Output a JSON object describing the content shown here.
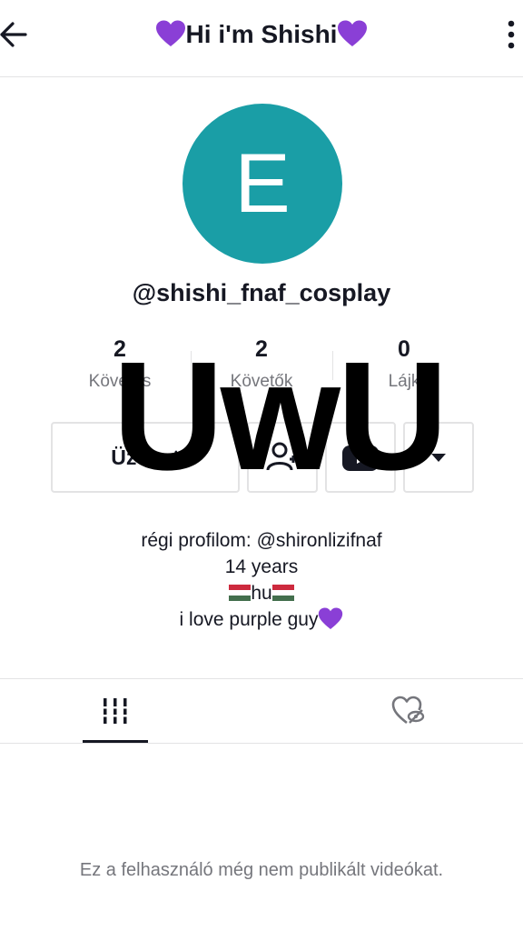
{
  "header": {
    "title": "Hi i'm Shishi",
    "back_icon": "arrow-left-icon",
    "more_icon": "more-vertical-icon",
    "heart_icon": "purple-heart-icon"
  },
  "profile": {
    "avatar_letter": "E",
    "avatar_color": "#1a9ea6",
    "username": "@shishi_fnaf_cosplay"
  },
  "stats": [
    {
      "value": "2",
      "label": "Követés"
    },
    {
      "value": "2",
      "label": "Követők"
    },
    {
      "value": "0",
      "label": "Lájk"
    }
  ],
  "actions": {
    "message_label": "Üzenet",
    "follow_icon": "user-follow-icon",
    "youtube_icon": "youtube-icon",
    "dropdown_icon": "caret-down-icon"
  },
  "overlay_text": "UwU",
  "bio": {
    "line1": "régi profilom: @shironlizifnaf",
    "line2": "14 years",
    "line3": "hu",
    "line4": "i love purple guy"
  },
  "tabs": [
    {
      "icon": "grid-icon",
      "active": true
    },
    {
      "icon": "liked-hidden-icon",
      "active": false
    }
  ],
  "empty_message": "Ez a felhasználó még nem publikált videókat.",
  "colors": {
    "accent_purple": "#8a3fd6",
    "avatar": "#1a9ea6",
    "hungary_red": "#cd2a3e",
    "hungary_green": "#436f4d"
  }
}
